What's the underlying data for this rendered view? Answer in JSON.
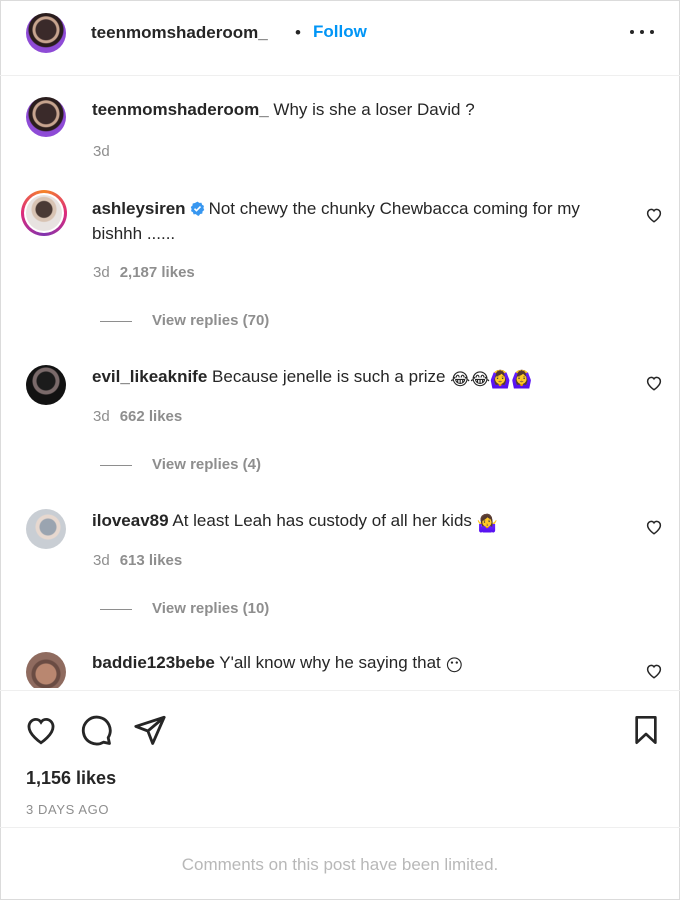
{
  "header": {
    "username": "teenmomshaderoom_",
    "separator": "•",
    "follow_label": "Follow",
    "more_icon": "more-horizontal-icon"
  },
  "caption": {
    "username": "teenmomshaderoom_",
    "text": "Why is she a loser David ?",
    "time": "3d"
  },
  "comments": [
    {
      "username": "ashleysiren",
      "verified": true,
      "text": "Not chewy the chunky Chewbacca coming for my bishhh ......",
      "time": "3d",
      "likes": "2,187 likes",
      "replies": "View replies (70)"
    },
    {
      "username": "evil_likeaknife",
      "verified": false,
      "text": "Because jenelle is such a prize",
      "emoji": "😂😂🙆‍♀️🙆‍♀️",
      "time": "3d",
      "likes": "662 likes",
      "replies": "View replies (4)"
    },
    {
      "username": "iloveav89",
      "verified": false,
      "text": "At least Leah has custody of all her kids",
      "emoji": "🤷‍♀️",
      "time": "3d",
      "likes": "613 likes",
      "replies": "View replies (10)"
    },
    {
      "username": "baddie123bebe",
      "verified": false,
      "text": "Y'all know why he saying that",
      "emoji": "😶"
    }
  ],
  "actions": {
    "like_icon": "heart-icon",
    "comment_icon": "comment-icon",
    "share_icon": "share-icon",
    "save_icon": "bookmark-icon"
  },
  "post": {
    "likes": "1,156 likes",
    "date": "3 DAYS AGO"
  },
  "footer": {
    "limited_text": "Comments on this post have been limited."
  },
  "colors": {
    "link_blue": "#0095f6",
    "verified_blue": "#3897f0",
    "secondary_text": "#8e8e8e",
    "divider": "#efefef"
  }
}
